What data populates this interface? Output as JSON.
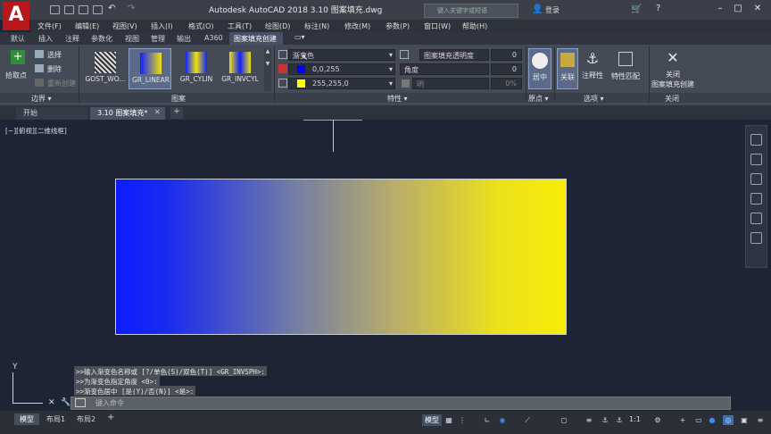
{
  "app": {
    "title": "Autodesk AutoCAD 2018    3.10 图案填充.dwg",
    "logo": "A",
    "search_placeholder": "键入关键字或短语",
    "login": "登录"
  },
  "menubar": [
    "文件(F)",
    "编辑(E)",
    "视图(V)",
    "插入(I)",
    "格式(O)",
    "工具(T)",
    "绘图(D)",
    "标注(N)",
    "修改(M)",
    "参数(P)",
    "窗口(W)",
    "帮助(H)"
  ],
  "ribbon_tabs": [
    "默认",
    "插入",
    "注释",
    "参数化",
    "视图",
    "管理",
    "输出",
    "A360",
    "图案填充创建"
  ],
  "active_ribbon_tab": "图案填充创建",
  "boundary": {
    "pick_point": "拾取点",
    "select": "选择",
    "remove": "删除",
    "recreate": "重新创建",
    "panel_label": "边界 ▾"
  },
  "patterns": {
    "items": [
      "GOST_WO...",
      "GR_LINEAR",
      "GR_CYLIN",
      "GR_INVCYL"
    ],
    "panel_label": "图案"
  },
  "properties": {
    "type": "渐变色",
    "color1": "0,0,255",
    "color2": "255,255,0",
    "transparency_label": "图案填充透明度",
    "transparency_value": "0",
    "angle_label": "角度",
    "angle_value": "0",
    "tint_label": "明",
    "tint_value": "0%",
    "panel_label": "特性 ▾",
    "color1_hex": "#0000ff",
    "color2_hex": "#ffff00"
  },
  "origin": {
    "center": "居中",
    "panel_label": "原点 ▾"
  },
  "options": {
    "associative": "关联",
    "annotative": "注释性",
    "match": "特性匹配",
    "panel_label": "选项 ▾"
  },
  "close": {
    "line1": "关闭",
    "line2": "图案填充创建",
    "panel_label": "关闭"
  },
  "doc_tabs": [
    "开始",
    "3.10 图案填充*"
  ],
  "view_label": "[−][俯视][二维线框]",
  "command": {
    "history": [
      ">>输入渐变色名称或 [?/单色(S)/双色(T)] <GR_INVSPH>:",
      ">>为渐变色指定角度 <0>:",
      ">>渐变色居中 [是(Y)/否(N)] <是>:"
    ],
    "prompt": "键入命令"
  },
  "layout_tabs": [
    "模型",
    "布局1",
    "布局2"
  ],
  "status": {
    "model": "模型",
    "scale": "1:1"
  },
  "ucs": {
    "y": "Y"
  }
}
